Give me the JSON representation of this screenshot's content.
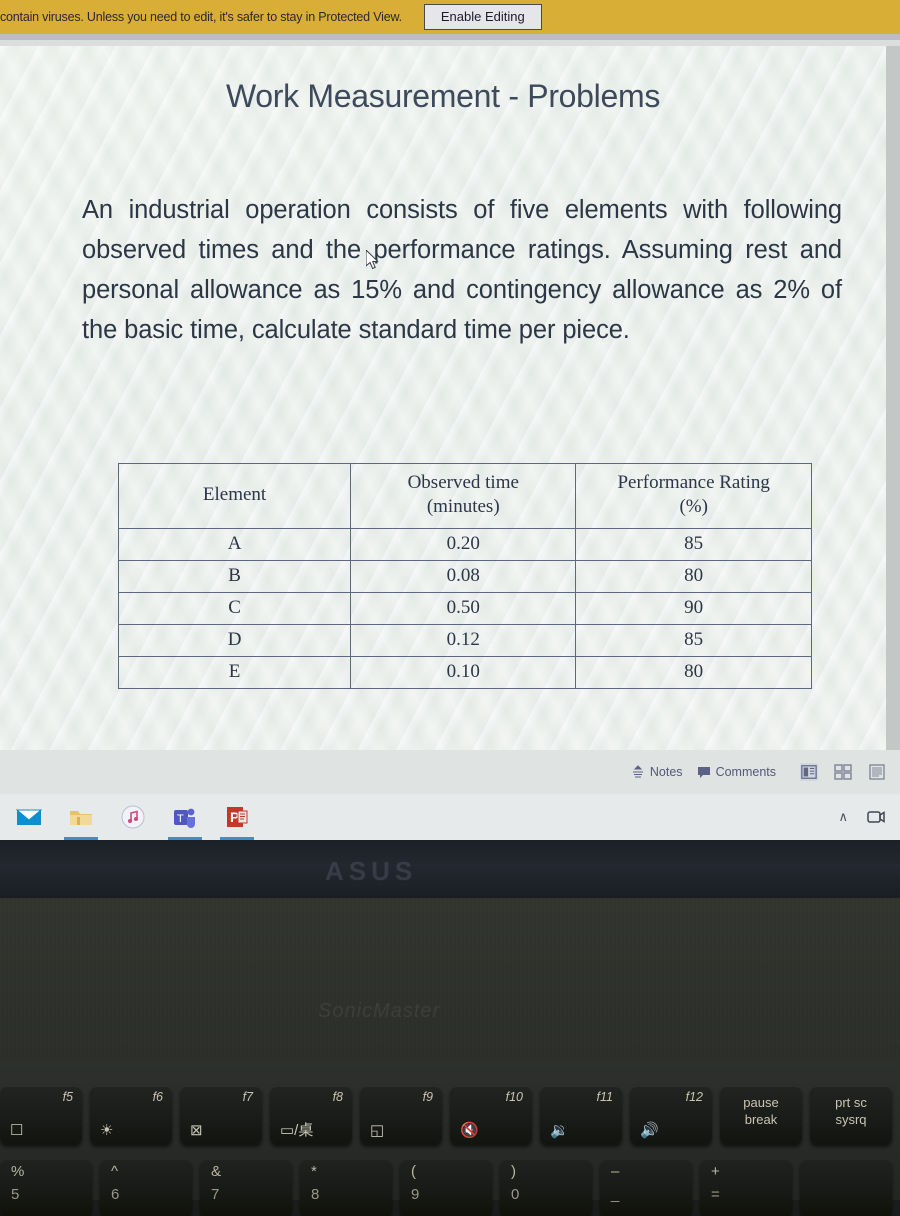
{
  "protected_view": {
    "message": "contain viruses. Unless you need to edit, it's safer to stay in Protected View.",
    "enable_button": "Enable Editing",
    "bar_color": "#d9ae37"
  },
  "slide": {
    "title": "Work Measurement - Problems",
    "body": "An industrial operation consists of five elements with following observed times and the performance ratings. Assuming rest and personal allowance as 15% and contingency allowance as 2% of the basic time, calculate standard time per piece.",
    "table": {
      "headers": [
        "Element",
        "Observed time (minutes)",
        "Performance Rating (%)"
      ],
      "header_lines": [
        [
          "Element"
        ],
        [
          "Observed time",
          "(minutes)"
        ],
        [
          "Performance Rating",
          "(%)"
        ]
      ],
      "rows": [
        [
          "A",
          "0.20",
          "85"
        ],
        [
          "B",
          "0.08",
          "80"
        ],
        [
          "C",
          "0.50",
          "90"
        ],
        [
          "D",
          "0.12",
          "85"
        ],
        [
          "E",
          "0.10",
          "80"
        ]
      ]
    }
  },
  "status_bar": {
    "notes_label": "Notes",
    "comments_label": "Comments",
    "view_icons": [
      "normal-view-icon",
      "slide-sorter-icon",
      "reading-view-icon"
    ]
  },
  "taskbar": {
    "items": [
      {
        "name": "mail-icon",
        "label": "Mail"
      },
      {
        "name": "file-explorer-icon",
        "label": "File Explorer"
      },
      {
        "name": "itunes-icon",
        "label": "iTunes"
      },
      {
        "name": "teams-icon",
        "label": "Microsoft Teams"
      },
      {
        "name": "powerpoint-icon",
        "label": "PowerPoint"
      }
    ],
    "tray": {
      "chevron": "∧",
      "camera_label": "Camera"
    }
  },
  "laptop": {
    "hinge_logo": "ASUS",
    "palm_logo": "SonicMaster",
    "function_keys": [
      {
        "label": "f5",
        "glyph": "⬜",
        "name": "f5"
      },
      {
        "label": "f6",
        "glyph": "☀",
        "name": "f6-keyboard-backlight"
      },
      {
        "label": "f7",
        "glyph": "⊠",
        "name": "f7-display-off"
      },
      {
        "label": "f8",
        "glyph": "▭/桌",
        "name": "f8-display-switch"
      },
      {
        "label": "f9",
        "glyph": "◱",
        "name": "f9-touchpad-toggle"
      },
      {
        "label": "f10",
        "glyph": "✕",
        "name": "f10-mute"
      },
      {
        "label": "f11",
        "glyph": "🔉",
        "name": "f11-volume-down"
      },
      {
        "label": "f12",
        "glyph": "🔊",
        "name": "f12-volume-up"
      }
    ],
    "special_keys": [
      {
        "lines": [
          "pause",
          "break"
        ],
        "name": "pause-break-key"
      },
      {
        "lines": [
          "prt sc",
          "sysrq"
        ],
        "name": "print-screen-key"
      }
    ],
    "number_keys": [
      {
        "top": "%",
        "bottom": "5"
      },
      {
        "top": "^",
        "bottom": "6"
      },
      {
        "top": "&",
        "bottom": "7"
      },
      {
        "top": "*",
        "bottom": "8"
      },
      {
        "top": "(",
        "bottom": "9"
      },
      {
        "top": ")",
        "bottom": "0"
      },
      {
        "top": "–",
        "bottom": "_"
      },
      {
        "top": "+",
        "bottom": "="
      }
    ]
  }
}
